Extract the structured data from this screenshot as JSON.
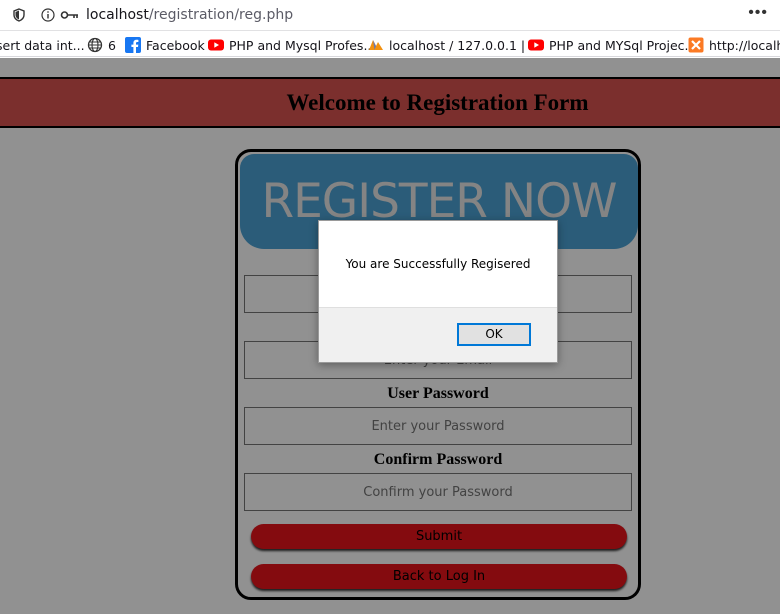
{
  "browser": {
    "url_host": "localhost",
    "url_path": "/registration/reg.php",
    "menu": "•••"
  },
  "bookmarks": [
    {
      "label": "sert data int...",
      "icon": "page-icon"
    },
    {
      "label": "6",
      "icon": "globe-icon"
    },
    {
      "label": "Facebook",
      "icon": "facebook-icon"
    },
    {
      "label": "PHP and Mysql Profes...",
      "icon": "youtube-icon"
    },
    {
      "label": "localhost / 127.0.0.1 | ...",
      "icon": "phpmyadmin-icon"
    },
    {
      "label": "PHP and MYSql Projec...",
      "icon": "youtube-icon"
    },
    {
      "label": "http://localho",
      "icon": "xampp-icon"
    }
  ],
  "page": {
    "heading": "Welcome to Registration Form",
    "banner": "REGISTER NOW",
    "field1_placeholder": "",
    "field2_placeholder": "Enter your Email",
    "password_label": "User Password",
    "password_placeholder": "Enter your Password",
    "confirm_label": "Confirm Password",
    "confirm_placeholder": "Confirm your Password",
    "submit_label": "Submit",
    "login_label": "Back to Log In"
  },
  "dialog": {
    "message": "You are Successfully Regisered",
    "ok_label": "OK"
  },
  "colors": {
    "header": "#d9534f",
    "banner": "#4da3d5",
    "button": "#e8141c",
    "focus": "#0078d7"
  }
}
